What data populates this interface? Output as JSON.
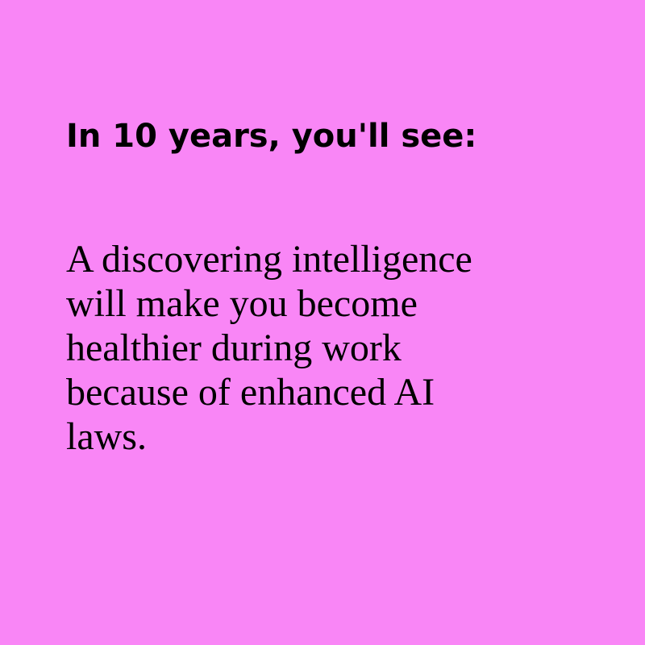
{
  "theme": {
    "background": "#F986F6",
    "text_color": "#000000"
  },
  "heading": "In 10 years, you'll see:",
  "body_lines": [
    "A discovering intelligence",
    "will make you become",
    "healthier during work",
    "because of enhanced AI",
    "laws."
  ]
}
